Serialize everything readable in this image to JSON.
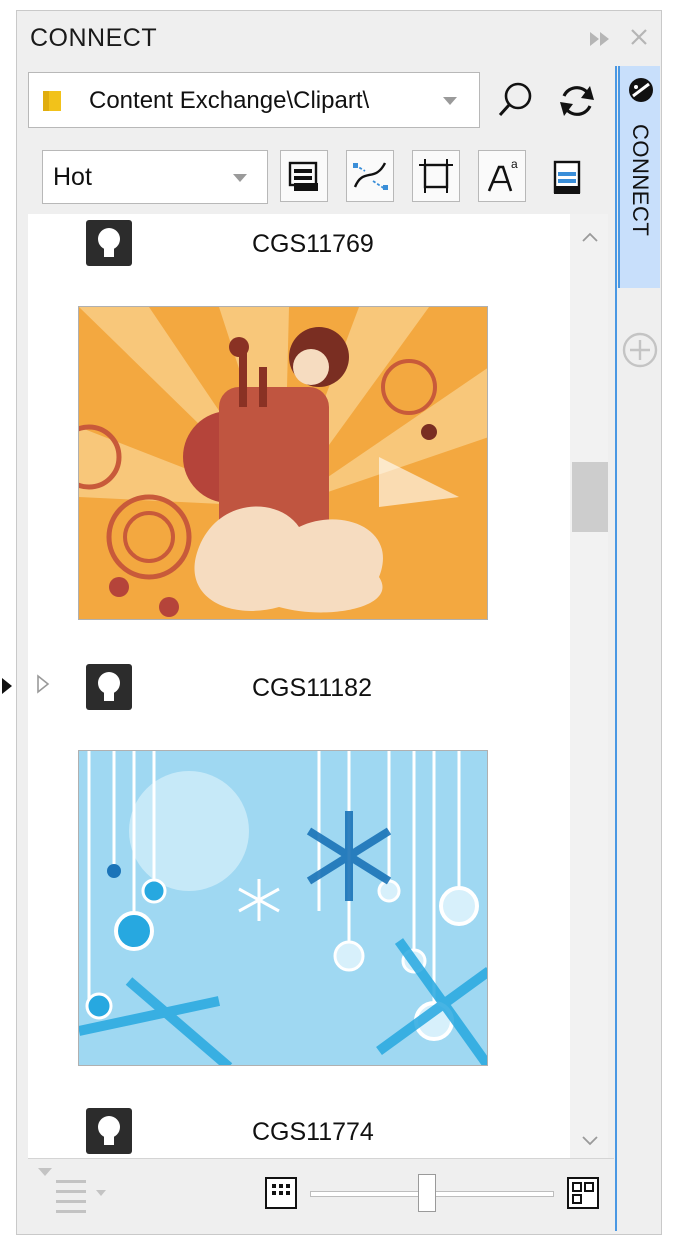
{
  "panel": {
    "title": "CONNECT",
    "expand_glyph": "⏩",
    "close_glyph": "✕"
  },
  "path_combo": {
    "value": "Content Exchange\\Clipart\\",
    "icon": "folder-icon"
  },
  "filter_combo": {
    "value": "Hot"
  },
  "toolbar_icons": [
    "open-folder-icon",
    "curve-icon",
    "crop-frame-icon",
    "text-style-icon",
    "document-icon"
  ],
  "side_tab": {
    "label": "CONNECT",
    "add_glyph": "⊕"
  },
  "items": [
    {
      "id": "CGS11769"
    },
    {
      "id": "CGS11182"
    },
    {
      "id": "CGS11774"
    }
  ],
  "bottom": {
    "zoom_fraction": 0.48
  },
  "colors": {
    "accent": "#4a98e3",
    "tab_bg": "#c8dffb",
    "panel_bg": "#efefef"
  }
}
